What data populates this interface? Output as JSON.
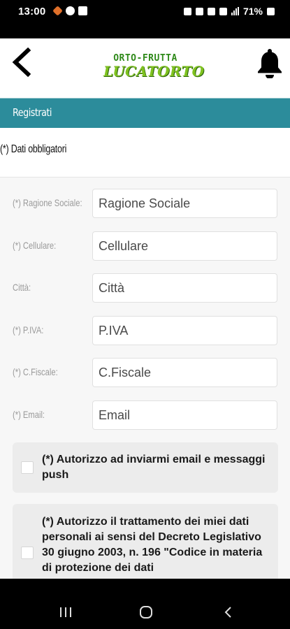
{
  "status": {
    "time": "13:00",
    "battery": "71%",
    "left_icons": [
      "heart-app-icon",
      "globe-icon",
      "image-icon"
    ],
    "right_icons": [
      "alarm-icon",
      "bluetooth-icon",
      "mute-icon",
      "wifi-icon",
      "signal-icon",
      "battery-icon"
    ]
  },
  "header": {
    "logo_top": "ORTO-FRUTTA",
    "logo_main": "LUCATORTO",
    "colors": {
      "logo_top": "#2f8a1a",
      "logo_main": "#7fc21f"
    }
  },
  "section": {
    "title": "Registrati",
    "color": "#2c8c9b"
  },
  "form": {
    "required_note": "(*) Dati obbligatori",
    "fields": [
      {
        "label": "(*) Ragione Sociale:",
        "placeholder": "Ragione Sociale"
      },
      {
        "label": "(*) Cellulare:",
        "placeholder": "Cellulare"
      },
      {
        "label": "Città:",
        "placeholder": "Città"
      },
      {
        "label": "(*) P.IVA:",
        "placeholder": "P.IVA"
      },
      {
        "label": "(*) C.Fiscale:",
        "placeholder": "C.Fiscale"
      },
      {
        "label": "(*) Email:",
        "placeholder": "Email"
      }
    ],
    "consents": [
      {
        "text": "(*) Autorizzo ad inviarmi email e messaggi push",
        "checked": false
      },
      {
        "text": "(*) Autorizzo il trattamento dei miei dati personali ai sensi del Decreto Legislativo 30 giugno 2003, n. 196 \"Codice in materia di protezione dei dati",
        "checked": false
      }
    ]
  },
  "nav": {
    "buttons": [
      "recents-icon",
      "home-icon",
      "back-icon"
    ]
  }
}
